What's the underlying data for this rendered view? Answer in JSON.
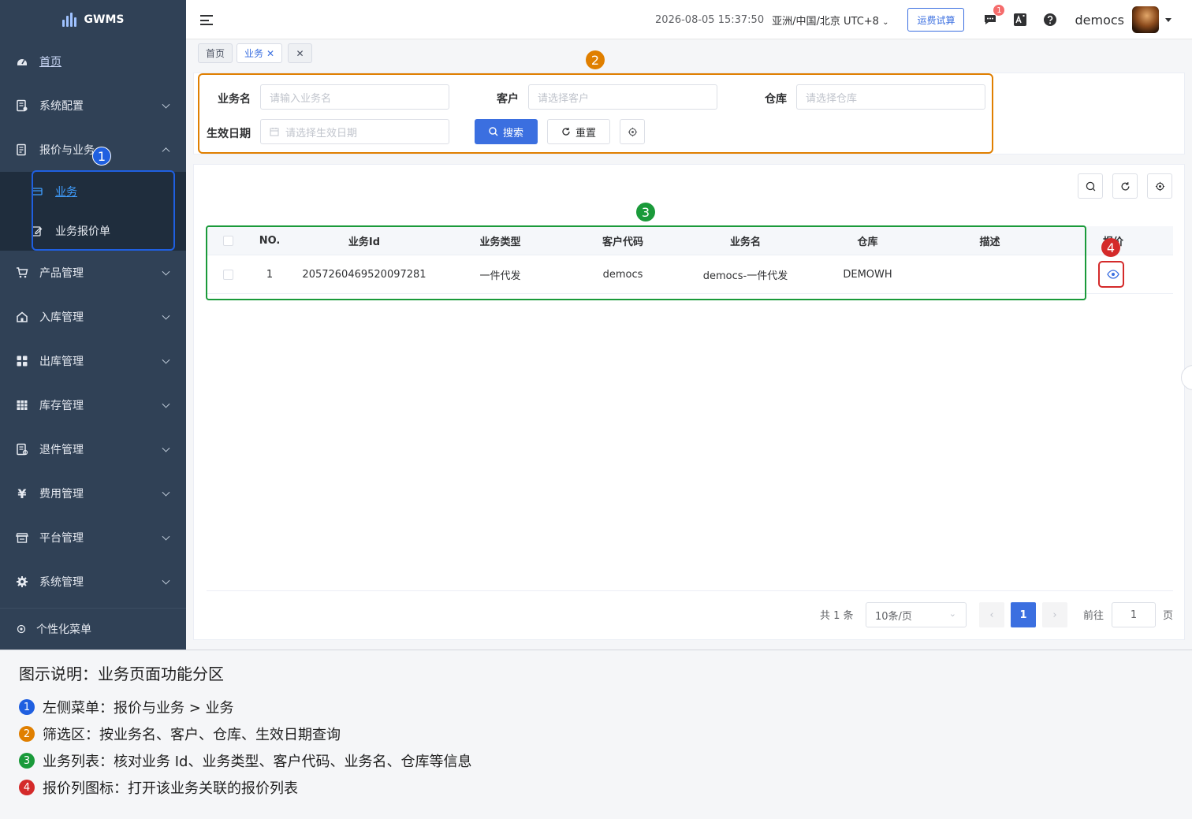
{
  "app": {
    "name": "GWMS"
  },
  "sidebar": {
    "items": [
      {
        "label": "首页",
        "icon": "dashboard-icon"
      },
      {
        "label": "系统配置",
        "icon": "system-config-icon"
      },
      {
        "label": "报价与业务",
        "icon": "quote-icon"
      },
      {
        "label": "产品管理",
        "icon": "cart-icon"
      },
      {
        "label": "入库管理",
        "icon": "home-icon"
      },
      {
        "label": "出库管理",
        "icon": "grid-icon"
      },
      {
        "label": "库存管理",
        "icon": "table-icon"
      },
      {
        "label": "退件管理",
        "icon": "return-icon"
      },
      {
        "label": "费用管理",
        "icon": "yen-icon"
      },
      {
        "label": "平台管理",
        "icon": "shop-icon"
      },
      {
        "label": "系统管理",
        "icon": "gear-icon"
      }
    ],
    "submenu": [
      {
        "label": "业务",
        "icon": "business-icon"
      },
      {
        "label": "业务报价单",
        "icon": "edit-icon"
      }
    ],
    "bottom": "个性化菜单"
  },
  "topbar": {
    "datetime": "2026-08-05 15:37:50",
    "timezone": "亚洲/中国/北京 UTC+8",
    "freight_btn": "运费试算",
    "message_badge": "1",
    "username": "democs"
  },
  "tags": [
    {
      "label": "首页"
    },
    {
      "label": "业务"
    },
    {
      "label": ""
    }
  ],
  "filter": {
    "name_label": "业务名",
    "name_placeholder": "请输入业务名",
    "customer_label": "客户",
    "customer_placeholder": "请选择客户",
    "warehouse_label": "仓库",
    "warehouse_placeholder": "请选择仓库",
    "date_label": "生效日期",
    "date_placeholder": "请选择生效日期",
    "search_btn": "搜索",
    "reset_btn": "重置"
  },
  "table": {
    "columns": [
      "NO.",
      "业务Id",
      "业务类型",
      "客户代码",
      "业务名",
      "仓库",
      "描述",
      "报价"
    ],
    "rows": [
      {
        "no": "1",
        "id": "2057260469520097281",
        "type": "一件代发",
        "customer": "democs",
        "name": "democs-一件代发",
        "warehouse": "DEMOWH",
        "desc": ""
      }
    ]
  },
  "pagination": {
    "total": "共 1 条",
    "page_size": "10条/页",
    "current": "1",
    "goto_label": "前往",
    "goto_value": "1",
    "page_suffix": "页"
  },
  "annotations": {
    "colors": {
      "1": "#1f5fe0",
      "2": "#e07f00",
      "3": "#1a9a3a",
      "4": "#d42a2a"
    },
    "n1": "1",
    "n2": "2",
    "n3": "3",
    "n4": "4"
  },
  "legend": {
    "title": "图示说明：业务页面功能分区",
    "items": [
      {
        "num": "1",
        "text": "左侧菜单：报价与业务 > 业务"
      },
      {
        "num": "2",
        "text": "筛选区：按业务名、客户、仓库、生效日期查询"
      },
      {
        "num": "3",
        "text": "业务列表：核对业务 Id、业务类型、客户代码、业务名、仓库等信息"
      },
      {
        "num": "4",
        "text": "报价列图标：打开该业务关联的报价列表"
      }
    ]
  }
}
